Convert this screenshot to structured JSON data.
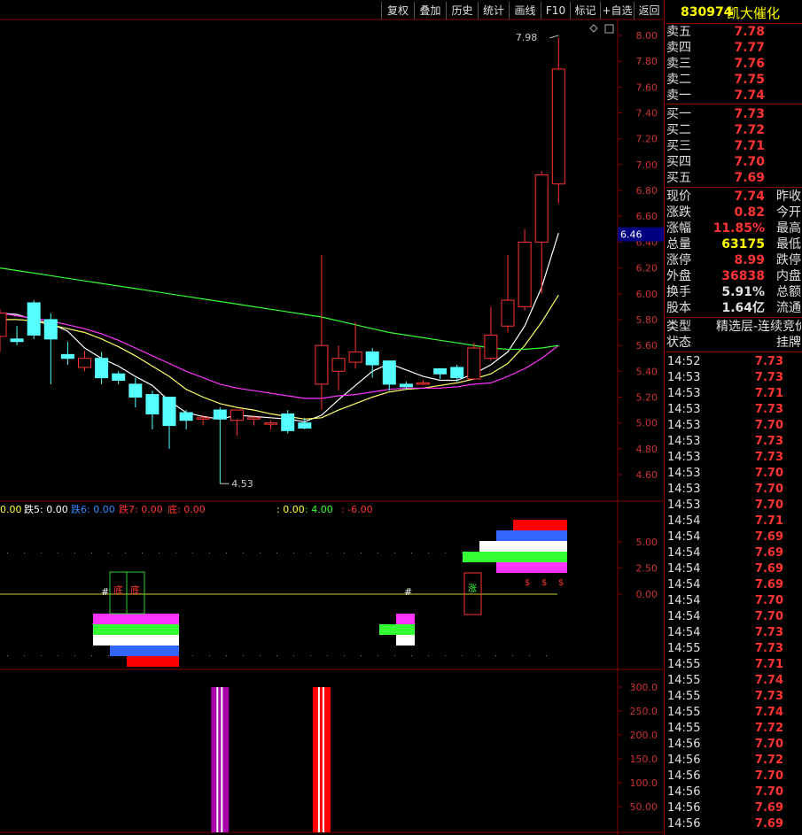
{
  "toolbar": {
    "buttons": [
      "复权",
      "叠加",
      "历史",
      "统计",
      "画线",
      "F10",
      "标记",
      "+自选",
      "返回"
    ]
  },
  "stock": {
    "code": "830974",
    "name": "凯大催化"
  },
  "orderbook": {
    "asks": [
      {
        "label": "卖五",
        "price": "7.78"
      },
      {
        "label": "卖四",
        "price": "7.77"
      },
      {
        "label": "卖三",
        "price": "7.76"
      },
      {
        "label": "卖二",
        "price": "7.75"
      },
      {
        "label": "卖一",
        "price": "7.74"
      }
    ],
    "bids": [
      {
        "label": "买一",
        "price": "7.73"
      },
      {
        "label": "买二",
        "price": "7.72"
      },
      {
        "label": "买三",
        "price": "7.71"
      },
      {
        "label": "买四",
        "price": "7.70"
      },
      {
        "label": "买五",
        "price": "7.69"
      }
    ]
  },
  "quote": [
    {
      "label": "现价",
      "value": "7.74",
      "right": "昨收",
      "color": "#ff3333"
    },
    {
      "label": "涨跌",
      "value": "0.82",
      "right": "今开",
      "color": "#ff3333"
    },
    {
      "label": "涨幅",
      "value": "11.85%",
      "right": "最高",
      "color": "#ff3333"
    },
    {
      "label": "总量",
      "value": "63175",
      "right": "最低",
      "color": "#ffff00"
    },
    {
      "label": "涨停",
      "value": "8.99",
      "right": "跌停",
      "color": "#ff3333"
    },
    {
      "label": "外盘",
      "value": "36838",
      "right": "内盘",
      "color": "#ff3333"
    },
    {
      "label": "换手",
      "value": "5.91%",
      "right": "总额",
      "color": "#e0e0e0"
    },
    {
      "label": "股本",
      "value": "1.64亿",
      "right": "流通",
      "color": "#e0e0e0"
    }
  ],
  "category": {
    "type_label": "类型",
    "type_value": "精选层-连续竞价",
    "status_label": "状态",
    "status_value": "挂牌"
  },
  "ticks": [
    {
      "time": "14:52",
      "price": "7.73",
      "color": "#ff3333"
    },
    {
      "time": "14:53",
      "price": "7.73",
      "color": "#ff3333"
    },
    {
      "time": "14:53",
      "price": "7.71",
      "color": "#ff3333"
    },
    {
      "time": "14:53",
      "price": "7.73",
      "color": "#ff3333"
    },
    {
      "time": "14:53",
      "price": "7.70",
      "color": "#ff3333"
    },
    {
      "time": "14:53",
      "price": "7.73",
      "color": "#ff3333"
    },
    {
      "time": "14:53",
      "price": "7.73",
      "color": "#ff3333"
    },
    {
      "time": "14:53",
      "price": "7.70",
      "color": "#ff3333"
    },
    {
      "time": "14:53",
      "price": "7.70",
      "color": "#ff3333"
    },
    {
      "time": "14:53",
      "price": "7.70",
      "color": "#ff3333"
    },
    {
      "time": "14:54",
      "price": "7.71",
      "color": "#ff3333"
    },
    {
      "time": "14:54",
      "price": "7.69",
      "color": "#ff3333"
    },
    {
      "time": "14:54",
      "price": "7.69",
      "color": "#ff3333"
    },
    {
      "time": "14:54",
      "price": "7.69",
      "color": "#ff3333"
    },
    {
      "time": "14:54",
      "price": "7.69",
      "color": "#ff3333"
    },
    {
      "time": "14:54",
      "price": "7.70",
      "color": "#ff3333"
    },
    {
      "time": "14:54",
      "price": "7.70",
      "color": "#ff3333"
    },
    {
      "time": "14:54",
      "price": "7.73",
      "color": "#ff3333"
    },
    {
      "time": "14:55",
      "price": "7.73",
      "color": "#ff3333"
    },
    {
      "time": "14:55",
      "price": "7.71",
      "color": "#ff3333"
    },
    {
      "time": "14:55",
      "price": "7.74",
      "color": "#ff3333"
    },
    {
      "time": "14:55",
      "price": "7.73",
      "color": "#ff3333"
    },
    {
      "time": "14:55",
      "price": "7.74",
      "color": "#ff3333"
    },
    {
      "time": "14:55",
      "price": "7.72",
      "color": "#ff3333"
    },
    {
      "time": "14:56",
      "price": "7.70",
      "color": "#ff3333"
    },
    {
      "time": "14:56",
      "price": "7.72",
      "color": "#ff3333"
    },
    {
      "time": "14:56",
      "price": "7.70",
      "color": "#ff3333"
    },
    {
      "time": "14:56",
      "price": "7.70",
      "color": "#ff3333"
    },
    {
      "time": "14:56",
      "price": "7.69",
      "color": "#ff3333"
    },
    {
      "time": "14:56",
      "price": "7.69",
      "color": "#ff3333"
    }
  ],
  "chart_data": {
    "type": "candlestick",
    "price_axis": {
      "ticks": [
        "8.00",
        "7.80",
        "7.60",
        "7.40",
        "7.20",
        "7.00",
        "6.80",
        "6.60",
        "6.40",
        "6.20",
        "6.00",
        "5.80",
        "5.60",
        "5.40",
        "5.20",
        "5.00",
        "4.80",
        "4.60"
      ],
      "range": [
        4.45,
        8.15
      ]
    },
    "cursor_price": "6.46",
    "max_label": "7.98",
    "min_label": "4.53",
    "candles": [
      {
        "o": 5.67,
        "c": 5.85,
        "h": 5.88,
        "l": 5.55
      },
      {
        "o": 5.65,
        "c": 5.63,
        "h": 5.75,
        "l": 5.6
      },
      {
        "o": 5.93,
        "c": 5.68,
        "h": 5.95,
        "l": 5.65
      },
      {
        "o": 5.8,
        "c": 5.65,
        "h": 5.85,
        "l": 5.3
      },
      {
        "o": 5.53,
        "c": 5.5,
        "h": 5.63,
        "l": 5.45
      },
      {
        "o": 5.43,
        "c": 5.5,
        "h": 5.56,
        "l": 5.4
      },
      {
        "o": 5.5,
        "c": 5.35,
        "h": 5.55,
        "l": 5.3
      },
      {
        "o": 5.38,
        "c": 5.33,
        "h": 5.4,
        "l": 5.3
      },
      {
        "o": 5.3,
        "c": 5.2,
        "h": 5.35,
        "l": 5.12
      },
      {
        "o": 5.22,
        "c": 5.07,
        "h": 5.25,
        "l": 4.95
      },
      {
        "o": 5.2,
        "c": 4.98,
        "h": 5.2,
        "l": 4.8
      },
      {
        "o": 5.08,
        "c": 5.02,
        "h": 5.1,
        "l": 4.95
      },
      {
        "o": 5.04,
        "c": 5.04,
        "h": 5.06,
        "l": 4.98
      },
      {
        "o": 5.1,
        "c": 5.03,
        "h": 5.12,
        "l": 4.53
      },
      {
        "o": 5.02,
        "c": 5.1,
        "h": 5.1,
        "l": 4.9
      },
      {
        "o": 5.04,
        "c": 5.04,
        "h": 5.06,
        "l": 4.98
      },
      {
        "o": 5.0,
        "c": 5.0,
        "h": 5.02,
        "l": 4.95
      },
      {
        "o": 5.07,
        "c": 4.94,
        "h": 5.1,
        "l": 4.92
      },
      {
        "o": 5.0,
        "c": 4.96,
        "h": 5.04,
        "l": 4.95
      },
      {
        "o": 5.3,
        "c": 5.6,
        "h": 6.3,
        "l": 5.1
      },
      {
        "o": 5.4,
        "c": 5.5,
        "h": 5.6,
        "l": 5.25
      },
      {
        "o": 5.47,
        "c": 5.55,
        "h": 5.78,
        "l": 5.42
      },
      {
        "o": 5.55,
        "c": 5.45,
        "h": 5.58,
        "l": 5.35
      },
      {
        "o": 5.48,
        "c": 5.3,
        "h": 5.48,
        "l": 5.25
      },
      {
        "o": 5.3,
        "c": 5.28,
        "h": 5.32,
        "l": 5.26
      },
      {
        "o": 5.31,
        "c": 5.31,
        "h": 5.33,
        "l": 5.29
      },
      {
        "o": 5.42,
        "c": 5.38,
        "h": 5.42,
        "l": 5.34
      },
      {
        "o": 5.43,
        "c": 5.35,
        "h": 5.45,
        "l": 5.32
      },
      {
        "o": 5.34,
        "c": 5.58,
        "h": 5.62,
        "l": 5.33
      },
      {
        "o": 5.5,
        "c": 5.68,
        "h": 5.9,
        "l": 5.48
      },
      {
        "o": 5.75,
        "c": 5.95,
        "h": 6.3,
        "l": 5.7
      },
      {
        "o": 5.9,
        "c": 6.4,
        "h": 6.5,
        "l": 5.87
      },
      {
        "o": 6.4,
        "c": 6.92,
        "h": 6.95,
        "l": 6.0
      },
      {
        "o": 6.85,
        "c": 7.74,
        "h": 7.98,
        "l": 6.7
      }
    ],
    "ma": [
      {
        "name": "MA5",
        "color": "#ffffff",
        "values": [
          5.85,
          5.84,
          5.8,
          5.77,
          5.71,
          5.58,
          5.5,
          5.44,
          5.36,
          5.29,
          5.17,
          5.08,
          5.05,
          5.03,
          5.06,
          5.05,
          5.04,
          5.03,
          5.01,
          5.06,
          5.18,
          5.29,
          5.4,
          5.46,
          5.41,
          5.36,
          5.33,
          5.33,
          5.38,
          5.45,
          5.55,
          5.75,
          6.05,
          6.47
        ]
      },
      {
        "name": "MA10",
        "color": "#ffff66",
        "values": [
          5.8,
          5.8,
          5.79,
          5.76,
          5.73,
          5.7,
          5.65,
          5.59,
          5.52,
          5.44,
          5.36,
          5.26,
          5.2,
          5.15,
          5.12,
          5.1,
          5.07,
          5.05,
          5.03,
          5.04,
          5.1,
          5.15,
          5.2,
          5.24,
          5.26,
          5.27,
          5.29,
          5.31,
          5.34,
          5.38,
          5.46,
          5.6,
          5.78,
          5.99
        ]
      },
      {
        "name": "MA20",
        "color": "#ff33ff",
        "values": [
          5.85,
          5.83,
          5.81,
          5.79,
          5.76,
          5.73,
          5.69,
          5.64,
          5.58,
          5.52,
          5.46,
          5.4,
          5.35,
          5.3,
          5.27,
          5.25,
          5.23,
          5.21,
          5.19,
          5.19,
          5.21,
          5.22,
          5.24,
          5.26,
          5.27,
          5.27,
          5.27,
          5.28,
          5.3,
          5.31,
          5.36,
          5.42,
          5.5,
          5.6
        ]
      },
      {
        "name": "MA60",
        "color": "#33ff33",
        "values": [
          6.2,
          6.18,
          6.16,
          6.14,
          6.12,
          6.1,
          6.08,
          6.06,
          6.04,
          6.02,
          6.0,
          5.98,
          5.96,
          5.94,
          5.92,
          5.9,
          5.88,
          5.86,
          5.84,
          5.82,
          5.79,
          5.76,
          5.73,
          5.7,
          5.68,
          5.66,
          5.64,
          5.62,
          5.6,
          5.58,
          5.57,
          5.57,
          5.58,
          5.6
        ]
      }
    ],
    "indicator": {
      "legend": [
        {
          "text": "0.00",
          "color": "#ffff33"
        },
        {
          "text": "跌5: 0.00",
          "color": "#ffffff"
        },
        {
          "text": "跌6: 0.00",
          "color": "#3388ff"
        },
        {
          "text": "跌7: 0.00",
          "color": "#ff3333"
        },
        {
          "text": "底: 0.00",
          "color": "#ff3333"
        },
        {
          "text": ": 0.00",
          "color": "#ffff33"
        },
        {
          "text": ": 4.00",
          "color": "#33ff33"
        },
        {
          "text": ": -6.00",
          "color": "#ff3333"
        }
      ],
      "axis_ticks": [
        "5.00",
        "2.50",
        "0.00"
      ],
      "markers": {
        "hash": "#",
        "di": "底",
        "zhang": "涨",
        "dollar": "$"
      }
    },
    "volume": {
      "axis_ticks": [
        "300.0",
        "250.0",
        "200.0",
        "150.0",
        "100.0",
        "50.00"
      ],
      "bars": [
        {
          "candle": 13,
          "value": 300,
          "color": "#aa00aa"
        },
        {
          "candle": 19,
          "value": 300,
          "color": "#ff0000"
        }
      ]
    }
  }
}
